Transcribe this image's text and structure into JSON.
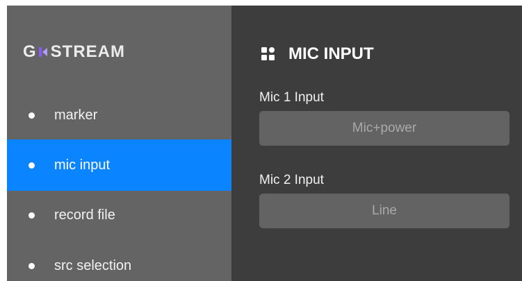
{
  "sidebar": {
    "logo_text_start": "G",
    "logo_text_end": "STREAM",
    "items": [
      {
        "label": "marker",
        "active": false
      },
      {
        "label": "mic input",
        "active": true
      },
      {
        "label": "record file",
        "active": false
      },
      {
        "label": "src selection",
        "active": false
      }
    ]
  },
  "main": {
    "section_icon": "grid-icon",
    "section_title": "MIC INPUT",
    "fields": [
      {
        "label": "Mic 1 Input",
        "value": "Mic+power"
      },
      {
        "label": "Mic 2 Input",
        "value": "Line"
      }
    ]
  },
  "colors": {
    "sidebar_bg": "#646464",
    "main_bg": "#3d3d3d",
    "active_accent": "#0a84ff",
    "logo_accent": "#8a5cf6",
    "select_bg": "#636363"
  }
}
